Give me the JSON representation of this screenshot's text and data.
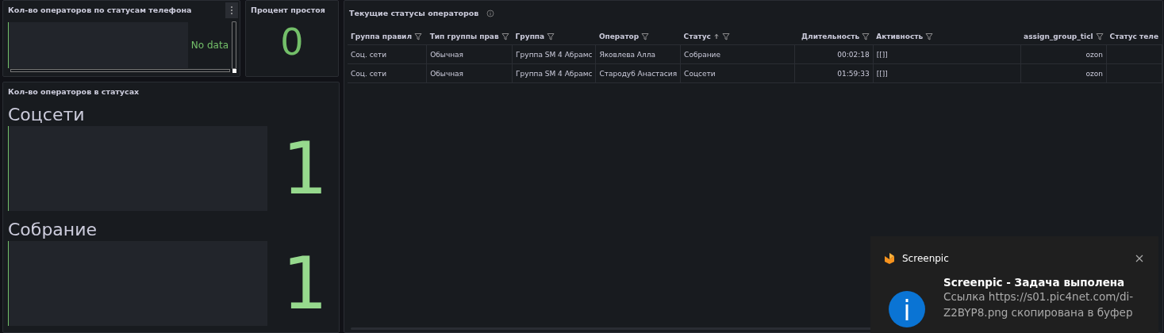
{
  "phone_panel": {
    "title": "Кол-во операторов по статусам телефона",
    "no_data": "No data"
  },
  "idle_panel": {
    "title": "Процент простоя",
    "value": "0"
  },
  "status_panel": {
    "title": "Кол-во операторов в статусах",
    "bars": [
      {
        "name": "Соцсети",
        "value": "1",
        "level": 0
      },
      {
        "name": "Собрание",
        "value": "1",
        "level": 0
      }
    ]
  },
  "table": {
    "title": "Текущие статусы операторов",
    "columns": [
      {
        "label": "Группа правил",
        "right_aligned": false,
        "sorted": false
      },
      {
        "label": "Тип группы прав",
        "right_aligned": false,
        "sorted": false
      },
      {
        "label": "Группа",
        "right_aligned": false,
        "sorted": false
      },
      {
        "label": "Оператор",
        "right_aligned": false,
        "sorted": false
      },
      {
        "label": "Статус",
        "right_aligned": false,
        "sorted": true
      },
      {
        "label": "Длительность",
        "right_aligned": true,
        "sorted": false
      },
      {
        "label": "Активность",
        "right_aligned": false,
        "sorted": false
      },
      {
        "label": "assign_group_ticl",
        "right_aligned": true,
        "sorted": false
      },
      {
        "label": "Статус теле",
        "right_aligned": false,
        "sorted": false,
        "filter": false
      }
    ],
    "rows": [
      [
        "Соц. сети",
        "Обычная",
        "Группа SM 4 Абрамс",
        "Яковлева Алла",
        "Собрание",
        "00:02:18",
        "[[]]",
        "ozon",
        ""
      ],
      [
        "Соц. сети",
        "Обычная",
        "Группа SM 4 Абрамс",
        "Стародуб Анастасия",
        "Соцсети",
        "01:59:33",
        "[[]]",
        "ozon",
        ""
      ]
    ]
  },
  "toast": {
    "app": "Screenpic",
    "title": "Screenpic - Задача выполена",
    "message": "Ссылка https://s01.pic4net.com/di-Z2BYP8.png скопирована в буфер"
  }
}
